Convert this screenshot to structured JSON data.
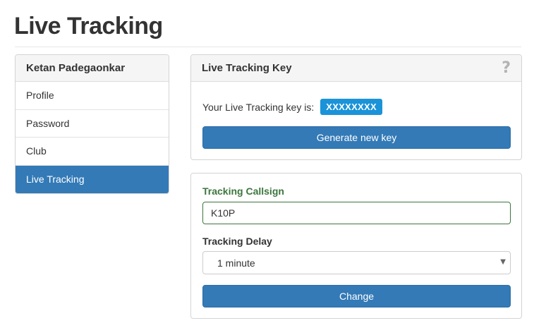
{
  "page": {
    "title": "Live Tracking"
  },
  "sidebar": {
    "user_name": "Ketan Padegaonkar",
    "items": [
      {
        "label": "Profile",
        "active": false
      },
      {
        "label": "Password",
        "active": false
      },
      {
        "label": "Club",
        "active": false
      },
      {
        "label": "Live Tracking",
        "active": true
      }
    ]
  },
  "key_panel": {
    "title": "Live Tracking Key",
    "help_icon": "question-mark-icon",
    "key_text": "Your Live Tracking key is:",
    "key_value": "XXXXXXXX",
    "generate_button_label": "Generate new key"
  },
  "tracking_panel": {
    "callsign_label": "Tracking Callsign",
    "callsign_value": "K10P",
    "delay_label": "Tracking Delay",
    "delay_value": "1 minute",
    "change_button_label": "Change"
  },
  "colors": {
    "primary": "#337ab7",
    "key_badge": "#1b93d9",
    "success_label": "#3c763d"
  }
}
